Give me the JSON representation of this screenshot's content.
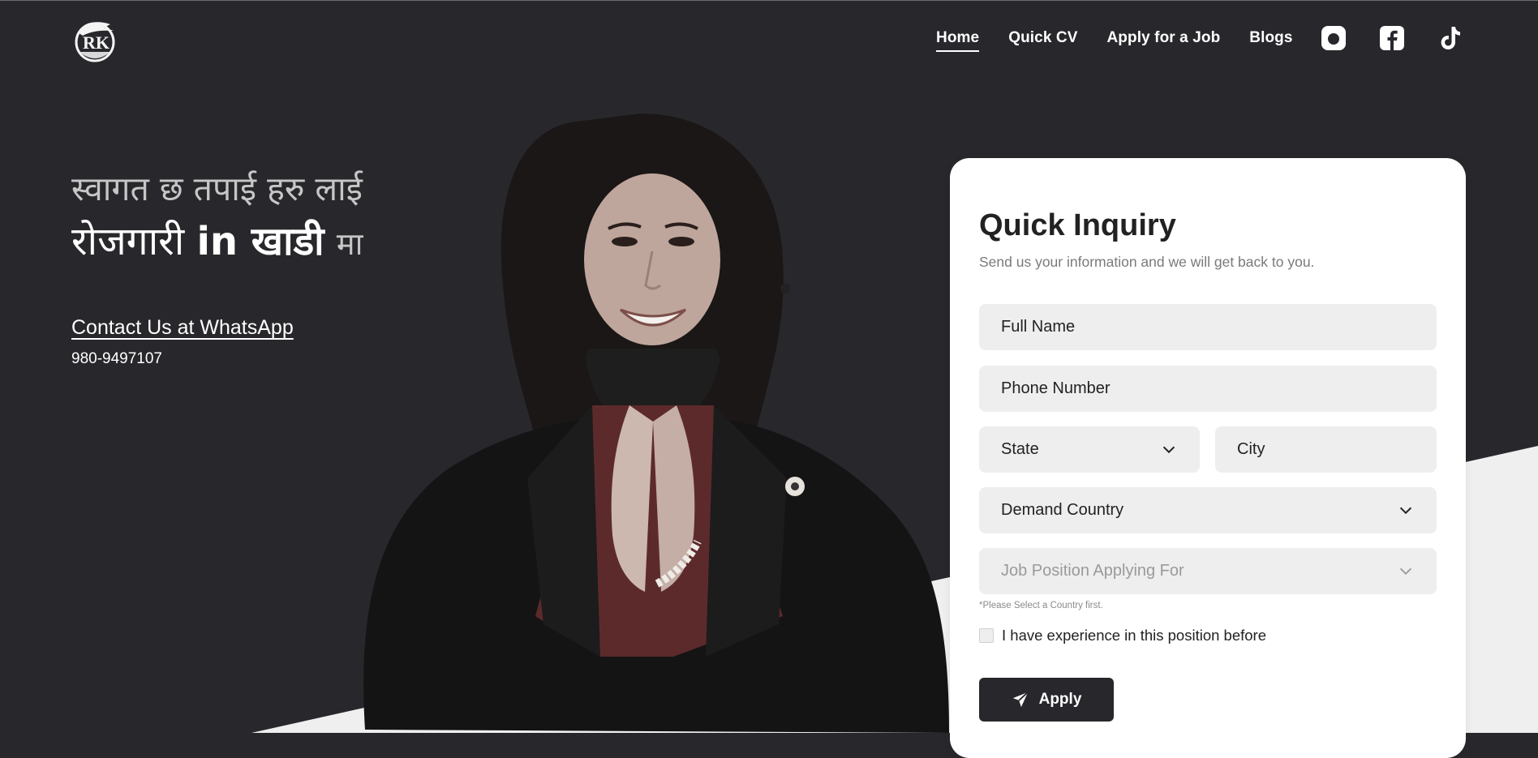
{
  "brand": {
    "logo_text": "RK"
  },
  "nav": {
    "items": [
      {
        "label": "Home",
        "active": true
      },
      {
        "label": "Quick CV",
        "active": false
      },
      {
        "label": "Apply for a Job",
        "active": false
      },
      {
        "label": "Blogs",
        "active": false
      }
    ]
  },
  "socials": [
    "instagram-icon",
    "facebook-icon",
    "tiktok-icon"
  ],
  "hero": {
    "greeting": "स्वागत छ तपाई हरु लाई",
    "headline_part1": "रोजगारी",
    "headline_part2": "in खाडी",
    "headline_part3": "मा",
    "contact_link": "Contact Us at WhatsApp",
    "phone": "980-9497107"
  },
  "form": {
    "title": "Quick Inquiry",
    "subtitle": "Send us your information and we will get back to you.",
    "full_name_placeholder": "Full Name",
    "phone_placeholder": "Phone Number",
    "state_label": "State",
    "city_placeholder": "City",
    "country_label": "Demand Country",
    "job_position_label": "Job Position Applying For",
    "hint": "*Please Select a Country first.",
    "experience_label": "I have experience in this position before",
    "experience_checked": false,
    "apply_label": "Apply"
  },
  "colors": {
    "background_dark": "#28282c",
    "background_light": "#efefef",
    "card": "#ffffff",
    "field": "#eeeeee",
    "button": "#28282c"
  }
}
